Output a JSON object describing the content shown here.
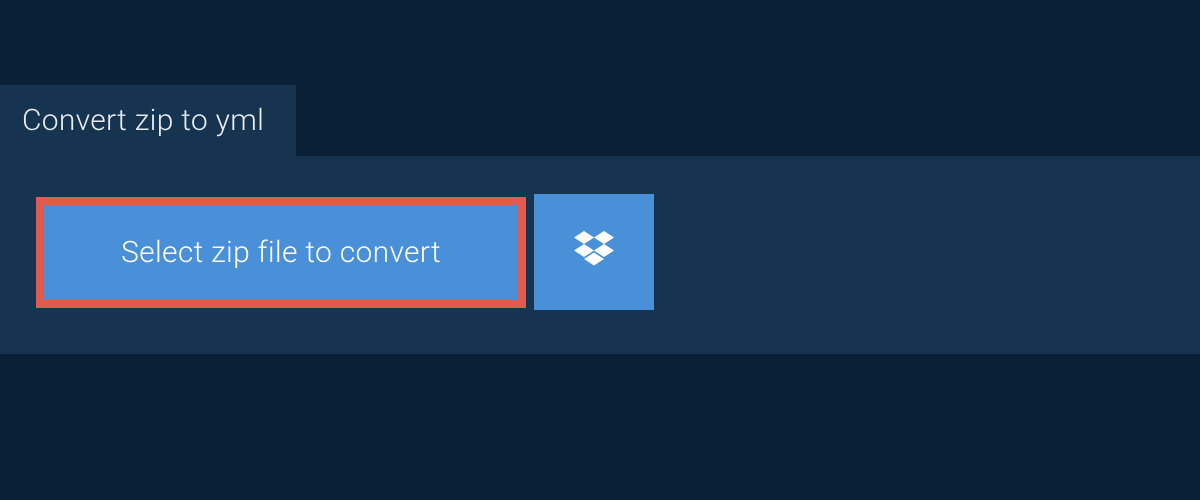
{
  "tab": {
    "title": "Convert zip to yml"
  },
  "upload": {
    "select_label": "Select zip file to convert"
  },
  "colors": {
    "background": "#0a2036",
    "panel": "#16334f",
    "button": "#4a90d9",
    "highlight_border": "#e05a4f",
    "text_light": "#e8eef4",
    "text_white": "#ffffff"
  },
  "icons": {
    "dropbox": "dropbox-icon"
  }
}
